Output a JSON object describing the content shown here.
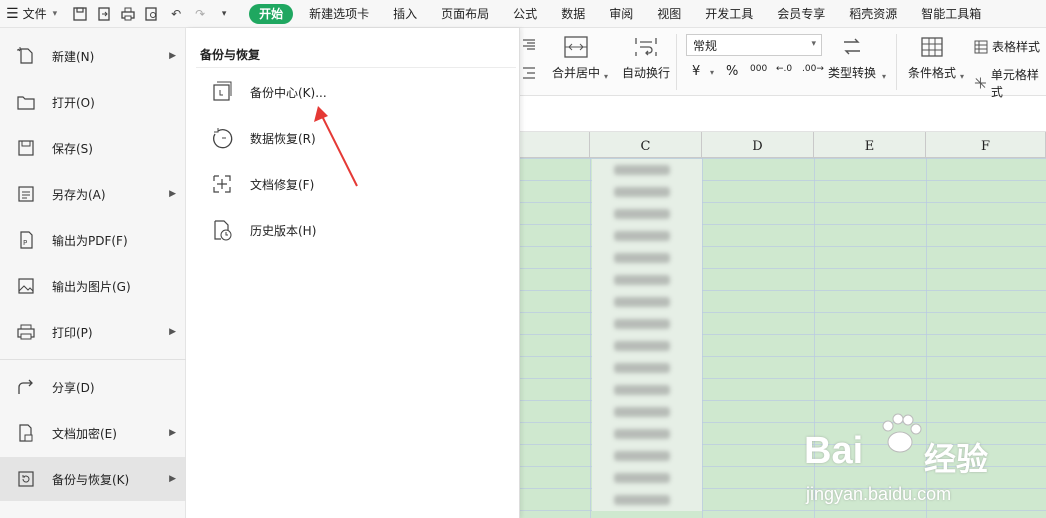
{
  "topbar": {
    "file_label": "文件",
    "tabs": [
      "开始",
      "新建选项卡",
      "插入",
      "页面布局",
      "公式",
      "数据",
      "审阅",
      "视图",
      "开发工具",
      "会员专享",
      "稻壳资源",
      "智能工具箱"
    ],
    "active_tab": "开始"
  },
  "ribbon": {
    "merge_center": "合并居中",
    "auto_wrap": "自动换行",
    "number_format": "常规",
    "yen": "¥",
    "percent": "%",
    "thousands": "000",
    "dec_inc": "←.0",
    "dec_dec": ".00→",
    "type_convert": "类型转换",
    "conditional_format": "条件格式",
    "table_style": "表格样式",
    "cell_style": "单元格样式"
  },
  "grid": {
    "columns": [
      "C",
      "D",
      "E",
      "F"
    ],
    "blurred_cell_text": "wkmao插件"
  },
  "file_menu": {
    "items": [
      {
        "label": "新建(N)",
        "icon": "new-doc-icon",
        "has_arrow": true
      },
      {
        "label": "打开(O)",
        "icon": "folder-open-icon",
        "has_arrow": false
      },
      {
        "label": "保存(S)",
        "icon": "save-icon",
        "has_arrow": false
      },
      {
        "label": "另存为(A)",
        "icon": "save-as-icon",
        "has_arrow": true
      },
      {
        "label": "输出为PDF(F)",
        "icon": "pdf-icon",
        "has_arrow": false
      },
      {
        "label": "输出为图片(G)",
        "icon": "image-export-icon",
        "has_arrow": false
      },
      {
        "label": "打印(P)",
        "icon": "print-icon",
        "has_arrow": true
      },
      {
        "label": "分享(D)",
        "icon": "share-icon",
        "has_arrow": false
      },
      {
        "label": "文档加密(E)",
        "icon": "encrypt-icon",
        "has_arrow": true
      },
      {
        "label": "备份与恢复(K)",
        "icon": "backup-icon",
        "has_arrow": true
      }
    ],
    "active_item": "备份与恢复(K)"
  },
  "submenu": {
    "title": "备份与恢复",
    "items": [
      {
        "label": "备份中心(K)...",
        "icon": "backup-center-icon"
      },
      {
        "label": "数据恢复(R)",
        "icon": "data-recovery-icon"
      },
      {
        "label": "文档修复(F)",
        "icon": "doc-repair-icon"
      },
      {
        "label": "历史版本(H)",
        "icon": "history-version-icon"
      }
    ]
  },
  "watermark": {
    "brand_left": "Bai",
    "brand_right": "经验",
    "url": "jingyan.baidu.com"
  },
  "colors": {
    "accent_green": "#1fa760",
    "grid_fill": "#cfe8cf",
    "arrow_red": "#e53935"
  }
}
